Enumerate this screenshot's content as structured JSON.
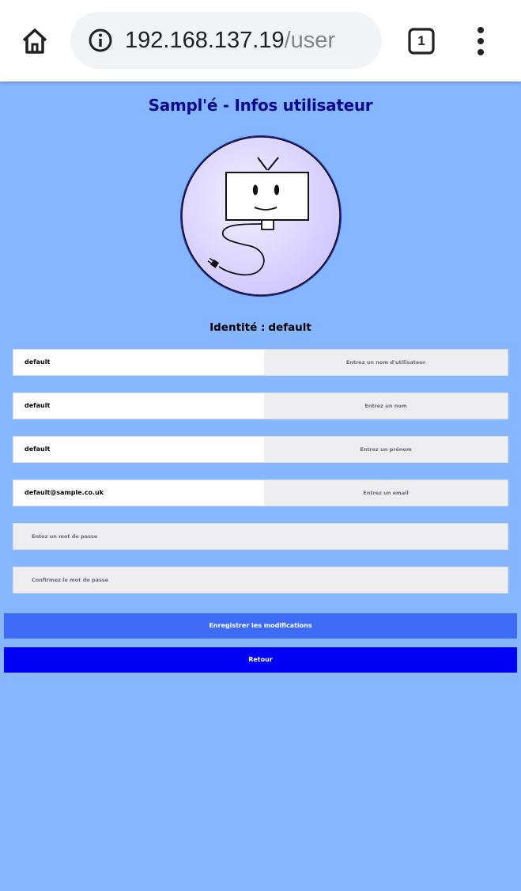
{
  "browser": {
    "url_host": "192.168.137.19",
    "url_path": "/user",
    "tab_count": "1",
    "icons": {
      "home": "home-icon",
      "info": "info-icon",
      "tabs": "tabs-icon",
      "menu": "more-vert-icon"
    }
  },
  "page": {
    "title": "Sampl'é - Infos utilisateur",
    "identity_label": "Identité :",
    "identity_value": "default",
    "fields": [
      {
        "value": "default",
        "hint": "Entrez un nom d'utilisateur"
      },
      {
        "value": "default",
        "hint": "Entrez un nom"
      },
      {
        "value": "default",
        "hint": "Entrez un prénom"
      },
      {
        "value": "default@sample.co.uk",
        "hint": "Entrez un email"
      }
    ],
    "password_placeholder": "Entez un mot de passe",
    "confirm_placeholder": "Confirmez le mot de passe",
    "save_label": "Enregistrer les modifications",
    "back_label": "Retour"
  },
  "colors": {
    "page_background": "#85b6ff",
    "title": "#0a0a8c",
    "save_button": "#3e6cf6",
    "back_button": "#0000f5",
    "logo_disc": "#dcd6ff",
    "logo_ring": "#3b3bd0"
  }
}
